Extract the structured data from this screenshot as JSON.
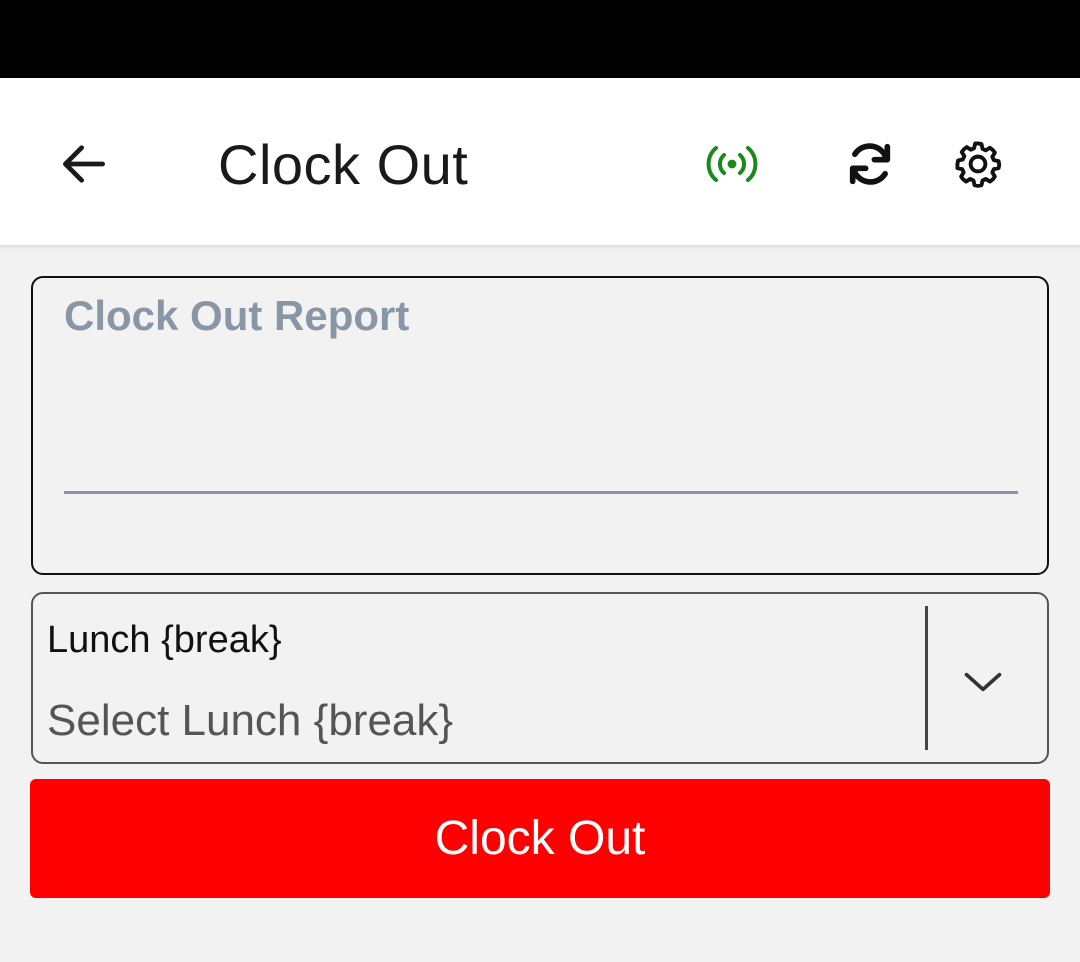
{
  "header": {
    "title": "Clock Out",
    "back_icon": "arrow-left-icon",
    "online_icon": "broadcast-signal-icon",
    "sync_icon": "sync-icon",
    "settings_icon": "gear-icon",
    "online_color": "#1a8a1a"
  },
  "report": {
    "label": "Clock Out Report",
    "value": ""
  },
  "lunch": {
    "label": "Lunch {break}",
    "placeholder": "Select Lunch {break}",
    "icon": "chevron-down-icon"
  },
  "action": {
    "label": "Clock Out",
    "color": "#ff0000"
  }
}
